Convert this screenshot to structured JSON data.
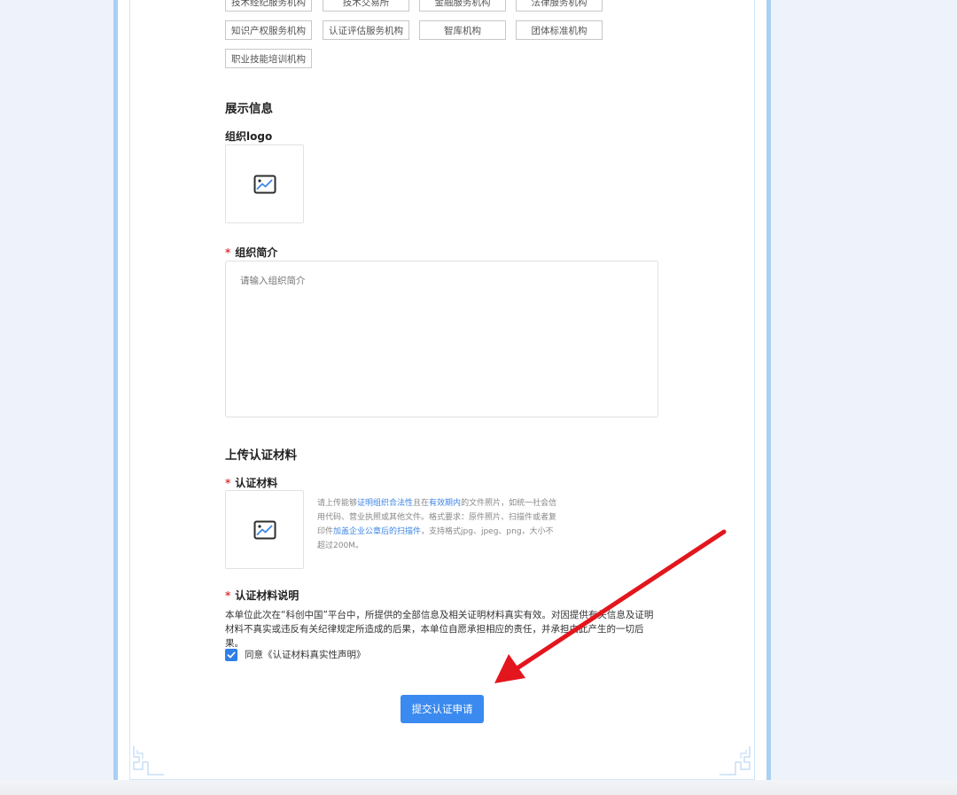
{
  "org_types": {
    "row1": [
      "技术经纪服务机构",
      "技术交易所",
      "金融服务机构",
      "法律服务机构"
    ],
    "row2": [
      "知识产权服务机构",
      "认证评估服务机构",
      "智库机构",
      "团体标准机构"
    ],
    "row3": [
      "职业技能培训机构"
    ]
  },
  "display_section": {
    "title": "展示信息",
    "logo_label": "组织logo",
    "intro_label": "组织简介",
    "intro_placeholder": "请输入组织简介",
    "required_mark": "*"
  },
  "upload_section": {
    "title": "上传认证材料",
    "material_label": "认证材料",
    "hint_parts": {
      "p1": "请上传能够",
      "h1": "证明组织合法性",
      "p2": "且在",
      "h2": "有效期内",
      "p3": "的文件照片，如统一社会信用代码、营业执照或其他文件。格式要求：原件照片、扫描件或者复印件",
      "h3": "加盖企业公章后的扫描件",
      "p4": "，支持格式jpg、jpeg、png，大小不超过200M。"
    },
    "declaration_label": "认证材料说明",
    "declaration_text": "本单位此次在“科创中国”平台中，所提供的全部信息及相关证明材料真实有效。对因提供有关信息及证明材料不真实或违反有关纪律规定所造成的后果，本单位自愿承担相应的责任，并承担由此产生的一切后果。",
    "agree_text": "同意《认证材料真实性声明》",
    "agree_checked": true
  },
  "submit_label": "提交认证申请",
  "icons": {
    "image_placeholder": "image-placeholder-icon",
    "check": "check-icon",
    "annotation_arrow": "red-arrow-annotation"
  },
  "colors": {
    "accent": "#3b8af0",
    "required": "#e0393e",
    "link": "#3d86e6",
    "frame": "#a9d0f2",
    "annotation": "#e3161d"
  }
}
